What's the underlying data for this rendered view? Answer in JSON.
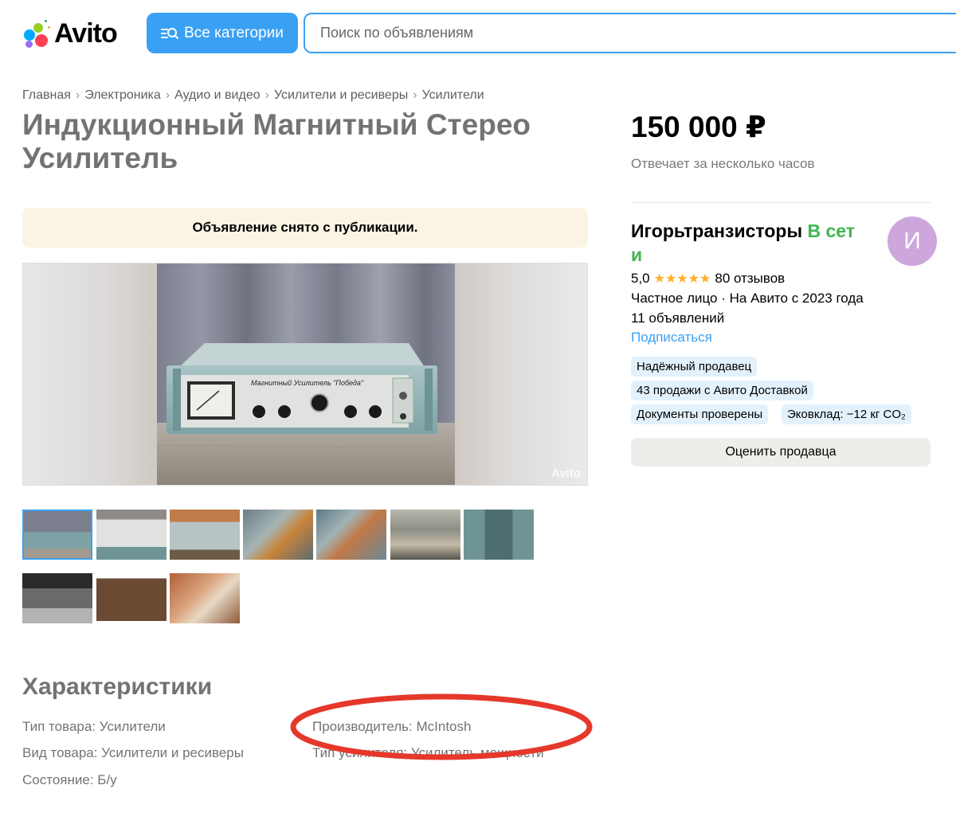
{
  "header": {
    "logo_text": "Avito",
    "categories_label": "Все категории",
    "search_placeholder": "Поиск по объявлениям"
  },
  "breadcrumb": [
    "Главная",
    "Электроника",
    "Аудио и видео",
    "Усилители и ресиверы",
    "Усилители"
  ],
  "listing": {
    "title": "Индукционный Магнитный Стерео Усилитель",
    "status_banner": "Объявление снято с публикации.",
    "photo_watermark": "Avito",
    "photo_panel_text": "Магнитный Усилитель \"Победа\"",
    "thumbnail_count": 10
  },
  "characteristics": {
    "title": "Характеристики",
    "items": [
      {
        "key": "Тип товара",
        "value": "Усилители"
      },
      {
        "key": "Вид товара",
        "value": "Усилители и ресиверы"
      },
      {
        "key": "Состояние",
        "value": "Б/у"
      },
      {
        "key": "Производитель",
        "value": "McIntosh"
      },
      {
        "key": "Тип усилителя",
        "value": "Усилитель мощности"
      }
    ]
  },
  "price": {
    "value": "150 000 ₽",
    "responds": "Отвечает за несколько часов"
  },
  "seller": {
    "name": "Игорьтранзисторы",
    "online_part1": "В сет",
    "online_part2": "и",
    "avatar_letter": "И",
    "rating": "5,0",
    "stars": "★★★★★",
    "reviews": "80 отзывов",
    "type_line": "Частное лицо · На Авито с 2023 года",
    "ads_count": "11 объявлений",
    "subscribe": "Подписаться",
    "badges": [
      "Надёжный продавец",
      "43 продажи с Авито Доставкой",
      "Документы проверены",
      "Эковклад: −12 кг CO₂"
    ],
    "rate_button": "Оценить продавца"
  },
  "colors": {
    "accent": "#3aa0f3",
    "online": "#3fb550",
    "star": "#ffb021",
    "banner_bg": "#fbf4e4",
    "avatar_bg": "#cda6dc",
    "annotation": "#e5382a"
  }
}
